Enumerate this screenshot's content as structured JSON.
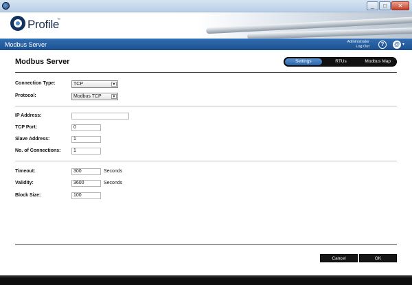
{
  "window": {
    "minimize_glyph": "_",
    "maximize_glyph": "□",
    "close_glyph": "✕"
  },
  "brand": {
    "logo_text": "Profile",
    "tm": "™"
  },
  "header": {
    "title": "Modbus Server",
    "user": "Administrator",
    "logout": "Log Out",
    "help_glyph": "?",
    "account_glyph": "@",
    "caret_glyph": "▾"
  },
  "page": {
    "title": "Modbus Server",
    "tabs": [
      {
        "label": "Settings",
        "active": true
      },
      {
        "label": "RTUs",
        "active": false
      },
      {
        "label": "Modbus Map",
        "active": false
      }
    ]
  },
  "form": {
    "connection_type": {
      "label": "Connection Type:",
      "value": "TCP"
    },
    "protocol": {
      "label": "Protocol:",
      "value": "Modbus TCP"
    },
    "ip_address": {
      "label": "IP Address:",
      "value": ""
    },
    "tcp_port": {
      "label": "TCP Port:",
      "value": "0"
    },
    "slave_address": {
      "label": "Slave Address:",
      "value": "1"
    },
    "connections": {
      "label": "No. of Connections:",
      "value": "1"
    },
    "timeout": {
      "label": "Timeout:",
      "value": "300",
      "unit": "Seconds"
    },
    "validity": {
      "label": "Validity:",
      "value": "3600",
      "unit": "Seconds"
    },
    "block_size": {
      "label": "Block Size:",
      "value": "100"
    }
  },
  "actions": {
    "cancel": "Cancel",
    "ok": "OK"
  },
  "icons": {
    "dropdown": "chevron-down-icon",
    "help": "help-icon",
    "account": "account-icon"
  }
}
